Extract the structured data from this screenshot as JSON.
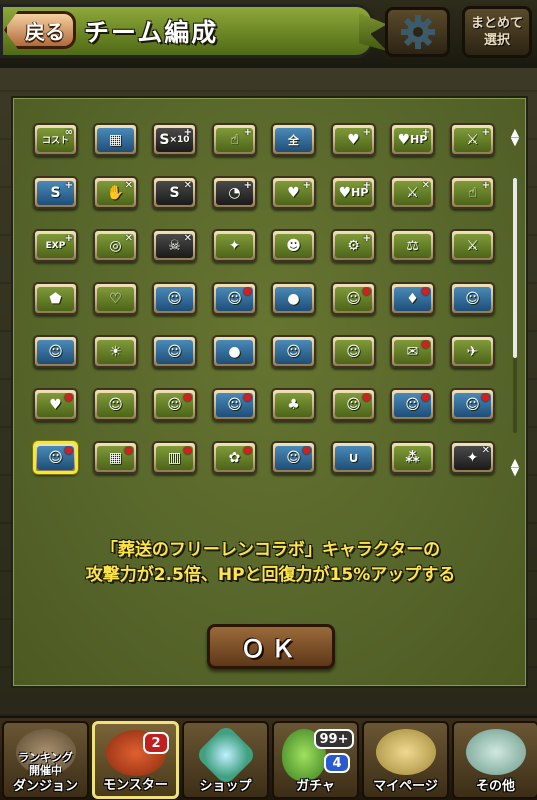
{
  "header": {
    "back_label": "戻る",
    "title": "チーム編成",
    "bulk_select_line1": "まとめて",
    "bulk_select_line2": "選択"
  },
  "dialog": {
    "badges": [
      {
        "name": "cost-badge",
        "text": "コスト",
        "glyph": "",
        "style": "green",
        "plus": "∞"
      },
      {
        "name": "limit-break-badge",
        "text": "",
        "glyph": "▦",
        "style": "blue",
        "plus": ""
      },
      {
        "name": "skill-x10-badge",
        "text": "×10",
        "glyph": "S",
        "style": "dark",
        "plus": "+"
      },
      {
        "name": "hand-plus-badge",
        "text": "",
        "glyph": "☝",
        "style": "green",
        "plus": "+"
      },
      {
        "name": "all-attribute-badge",
        "text": "全",
        "glyph": "",
        "style": "blue",
        "plus": ""
      },
      {
        "name": "heart-plus-badge",
        "text": "",
        "glyph": "♥",
        "style": "green",
        "plus": "+"
      },
      {
        "name": "hp-plus-badge",
        "text": "HP",
        "glyph": "♥",
        "style": "green",
        "plus": "+"
      },
      {
        "name": "sword-plus-badge",
        "text": "",
        "glyph": "⚔",
        "style": "green",
        "plus": "+"
      },
      {
        "name": "skill-boost-badge",
        "text": "",
        "glyph": "S",
        "style": "blue",
        "plus": "+"
      },
      {
        "name": "no-bind-badge",
        "text": "",
        "glyph": "✋",
        "style": "green",
        "plus": "✕"
      },
      {
        "name": "skill-block-badge",
        "text": "",
        "glyph": "S",
        "style": "dark",
        "plus": "✕"
      },
      {
        "name": "clock-badge",
        "text": "",
        "glyph": "◔",
        "style": "dark",
        "plus": "+"
      },
      {
        "name": "heart-boost-badge",
        "text": "",
        "glyph": "♥",
        "style": "green",
        "plus": "+"
      },
      {
        "name": "hp-boost-badge",
        "text": "HP",
        "glyph": "♥",
        "style": "green",
        "plus": "+"
      },
      {
        "name": "sword-boost-badge",
        "text": "",
        "glyph": "⚔",
        "style": "green",
        "plus": "✕"
      },
      {
        "name": "hand-boost-badge",
        "text": "",
        "glyph": "☝",
        "style": "green",
        "plus": "+"
      },
      {
        "name": "exp-badge",
        "text": "EXP",
        "glyph": "",
        "style": "green",
        "plus": "+"
      },
      {
        "name": "glasses-badge",
        "text": "",
        "glyph": "◎",
        "style": "green",
        "plus": "✕"
      },
      {
        "name": "skull-badge",
        "text": "",
        "glyph": "☠",
        "style": "dark",
        "plus": "✕"
      },
      {
        "name": "dragon-badge",
        "text": "",
        "glyph": "✦",
        "style": "green",
        "plus": ""
      },
      {
        "name": "demon-badge",
        "text": "",
        "glyph": "☻",
        "style": "green",
        "plus": ""
      },
      {
        "name": "gear-badge",
        "text": "",
        "glyph": "⚙",
        "style": "green",
        "plus": "+"
      },
      {
        "name": "balance-badge",
        "text": "",
        "glyph": "⚖",
        "style": "green",
        "plus": ""
      },
      {
        "name": "dragon-killer-badge",
        "text": "",
        "glyph": "⚔",
        "style": "green",
        "plus": ""
      },
      {
        "name": "shield-badge",
        "text": "",
        "glyph": "⬟",
        "style": "green",
        "plus": ""
      },
      {
        "name": "heart-frame-badge",
        "text": "",
        "glyph": "♡",
        "style": "green",
        "plus": ""
      },
      {
        "name": "collab-badge-1",
        "text": "",
        "glyph": "☺",
        "style": "blue",
        "plus": ""
      },
      {
        "name": "collab-badge-2",
        "text": "",
        "glyph": "☺",
        "style": "blue",
        "plus": "●"
      },
      {
        "name": "slime-badge",
        "text": "",
        "glyph": "●",
        "style": "blue",
        "plus": ""
      },
      {
        "name": "collab-badge-3",
        "text": "",
        "glyph": "☺",
        "style": "green",
        "plus": "●"
      },
      {
        "name": "collab-badge-4",
        "text": "",
        "glyph": "♦",
        "style": "blue",
        "plus": "●"
      },
      {
        "name": "kitty-badge",
        "text": "",
        "glyph": "☺",
        "style": "blue",
        "plus": ""
      },
      {
        "name": "collab-badge-5",
        "text": "",
        "glyph": "☺",
        "style": "blue",
        "plus": ""
      },
      {
        "name": "collab-badge-6",
        "text": "",
        "glyph": "☀",
        "style": "green",
        "plus": ""
      },
      {
        "name": "collab-badge-7",
        "text": "",
        "glyph": "☺",
        "style": "blue",
        "plus": ""
      },
      {
        "name": "mickey-badge",
        "text": "",
        "glyph": "●",
        "style": "blue",
        "plus": ""
      },
      {
        "name": "collab-badge-8",
        "text": "",
        "glyph": "☺",
        "style": "blue",
        "plus": ""
      },
      {
        "name": "collab-badge-9",
        "text": "",
        "glyph": "☺",
        "style": "green",
        "plus": ""
      },
      {
        "name": "collab-badge-10",
        "text": "",
        "glyph": "✉",
        "style": "green",
        "plus": "●"
      },
      {
        "name": "collab-badge-11",
        "text": "",
        "glyph": "✈",
        "style": "green",
        "plus": ""
      },
      {
        "name": "collab-badge-12",
        "text": "",
        "glyph": "♥",
        "style": "green",
        "plus": "●"
      },
      {
        "name": "collab-badge-13",
        "text": "",
        "glyph": "☺",
        "style": "green",
        "plus": ""
      },
      {
        "name": "collab-badge-14",
        "text": "",
        "glyph": "☺",
        "style": "green",
        "plus": "●"
      },
      {
        "name": "collab-badge-15",
        "text": "",
        "glyph": "☺",
        "style": "blue",
        "plus": "●"
      },
      {
        "name": "collab-badge-16",
        "text": "",
        "glyph": "♣",
        "style": "green",
        "plus": ""
      },
      {
        "name": "collab-badge-17",
        "text": "",
        "glyph": "☺",
        "style": "green",
        "plus": "●"
      },
      {
        "name": "collab-badge-18",
        "text": "",
        "glyph": "☺",
        "style": "blue",
        "plus": "●"
      },
      {
        "name": "collab-badge-19",
        "text": "",
        "glyph": "☺",
        "style": "blue",
        "plus": "●"
      },
      {
        "name": "frieren-badge",
        "text": "",
        "glyph": "☺",
        "style": "blue",
        "plus": "●"
      },
      {
        "name": "collab-badge-20",
        "text": "",
        "glyph": "▦",
        "style": "green",
        "plus": "●"
      },
      {
        "name": "collab-badge-21",
        "text": "",
        "glyph": "▥",
        "style": "green",
        "plus": "●"
      },
      {
        "name": "collab-badge-22",
        "text": "",
        "glyph": "✿",
        "style": "green",
        "plus": "●"
      },
      {
        "name": "collab-badge-23",
        "text": "",
        "glyph": "☺",
        "style": "blue",
        "plus": "●"
      },
      {
        "name": "collab-badge-24",
        "text": "",
        "glyph": "∪",
        "style": "blue",
        "plus": ""
      },
      {
        "name": "collab-badge-25",
        "text": "",
        "glyph": "⁂",
        "style": "green",
        "plus": ""
      },
      {
        "name": "collab-badge-26",
        "text": "",
        "glyph": "✦",
        "style": "dark",
        "plus": "✕"
      }
    ],
    "selected_index": 48,
    "description_line1": "「葬送のフリーレンコラボ」キャラクターの",
    "description_line2": "攻撃力が2.5倍、HPと回復力が15%アップする",
    "ok_label": "ＯＫ"
  },
  "nav": {
    "items": [
      {
        "name": "nav-dungeon",
        "label": "ダンジョン",
        "sub1": "ランキング",
        "sub2": "開催中",
        "color": "#7a6a4a"
      },
      {
        "name": "nav-monster",
        "label": "モンスター",
        "badge": "2",
        "color": "#b04020"
      },
      {
        "name": "nav-shop",
        "label": "ショップ",
        "color": "#6fc0a0"
      },
      {
        "name": "nav-gacha",
        "label": "ガチャ",
        "badge1": "99+",
        "badge2": "4",
        "color": "#6ab040"
      },
      {
        "name": "nav-mypage",
        "label": "マイページ",
        "color": "#d0b060"
      },
      {
        "name": "nav-other",
        "label": "その他",
        "color": "#9ac0b0"
      }
    ]
  },
  "colors": {
    "dialog_bg": "#5f6e2c",
    "description_text": "#ffe54a",
    "selected_border": "#f2ea2a"
  }
}
